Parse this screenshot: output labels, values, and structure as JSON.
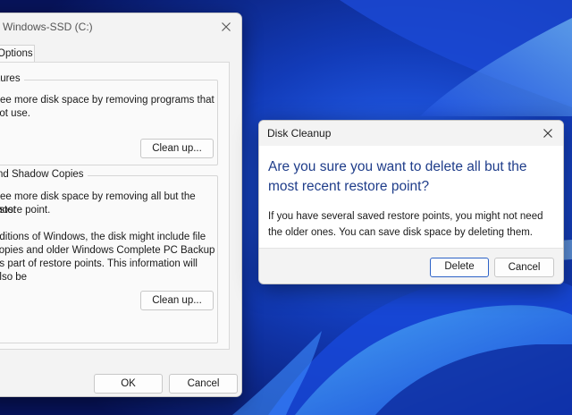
{
  "back_window": {
    "title": "Windows-SSD (C:)",
    "tab_label": "Options",
    "programs_group": {
      "legend": "tures",
      "lines": [
        "free more disk space by removing programs that",
        "not use."
      ],
      "button": "Clean up..."
    },
    "restore_group": {
      "legend": "nd Shadow Copies",
      "lines": [
        "free more disk space by removing all but the most",
        "estore point.",
        "",
        "editions of Windows, the disk might include file",
        "copies and older Windows Complete PC Backup",
        "as part of restore points. This information will also be",
        "."
      ],
      "button": "Clean up..."
    },
    "ok_label": "OK",
    "cancel_label": "Cancel"
  },
  "dialog": {
    "title": "Disk Cleanup",
    "heading": [
      "Are you sure you want to delete all but the",
      "most recent restore point?"
    ],
    "body": [
      "If you have several saved restore points, you might not need",
      "the older ones. You can save disk space by deleting them."
    ],
    "delete_label": "Delete",
    "cancel_label": "Cancel"
  },
  "icons": {
    "back_close": "close-icon",
    "dialog_close": "close-icon"
  },
  "colors": {
    "heading": "#1f3d8a",
    "default_button_border": "#2d62c7",
    "wallpaper_dark": "#0a1a6e",
    "wallpaper_bright": "#3aa0ff"
  }
}
